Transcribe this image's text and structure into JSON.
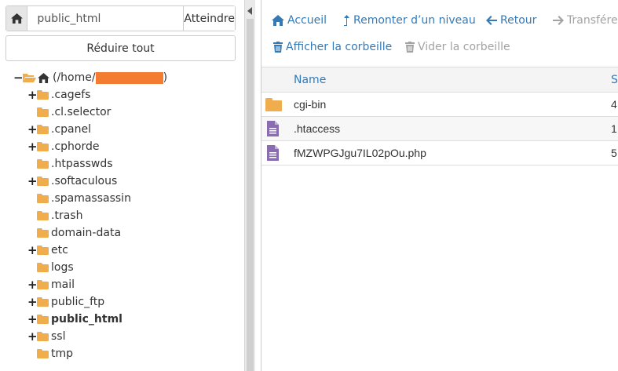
{
  "pathbar": {
    "home_icon": "home-icon",
    "path_value": "public_html",
    "go_label": "Atteindre"
  },
  "collapse_label": "Réduire tout",
  "tree": {
    "root": {
      "prefix": "(/home/",
      "suffix": ")",
      "redacted": true,
      "toggle": "−",
      "icons": [
        "folder-open-icon",
        "home-icon"
      ]
    },
    "items": [
      {
        "label": ".cagefs",
        "toggle": "+",
        "bold": false
      },
      {
        "label": ".cl.selector",
        "toggle": "",
        "bold": false
      },
      {
        "label": ".cpanel",
        "toggle": "+",
        "bold": false
      },
      {
        "label": ".cphorde",
        "toggle": "+",
        "bold": false
      },
      {
        "label": ".htpasswds",
        "toggle": "",
        "bold": false
      },
      {
        "label": ".softaculous",
        "toggle": "+",
        "bold": false
      },
      {
        "label": ".spamassassin",
        "toggle": "",
        "bold": false
      },
      {
        "label": ".trash",
        "toggle": "",
        "bold": false
      },
      {
        "label": "domain-data",
        "toggle": "",
        "bold": false
      },
      {
        "label": "etc",
        "toggle": "+",
        "bold": false
      },
      {
        "label": "logs",
        "toggle": "",
        "bold": false
      },
      {
        "label": "mail",
        "toggle": "+",
        "bold": false
      },
      {
        "label": "public_ftp",
        "toggle": "+",
        "bold": false
      },
      {
        "label": "public_html",
        "toggle": "+",
        "bold": true
      },
      {
        "label": "ssl",
        "toggle": "+",
        "bold": false
      },
      {
        "label": "tmp",
        "toggle": "",
        "bold": false
      }
    ]
  },
  "toolbar": {
    "home_label": "Accueil",
    "up_label": "Remonter d’un niveau",
    "back_label": "Retour",
    "forward_label": "Transférer",
    "trash_label": "Afficher la corbeille",
    "empty_trash_label": "Vider la corbeille"
  },
  "table": {
    "headers": {
      "name": "Name",
      "size": "S"
    },
    "rows": [
      {
        "name": "cgi-bin",
        "size": "4",
        "icon": "folder-icon"
      },
      {
        "name": ".htaccess",
        "size": "1",
        "icon": "file-text-icon"
      },
      {
        "name": "fMZWPGJgu7IL02pOu.php",
        "size": "5",
        "icon": "file-text-icon"
      }
    ]
  },
  "colors": {
    "link": "#337ab7",
    "folder": "#f0ad4e",
    "file_icon": "#8a6db1",
    "redaction": "#f47c30",
    "disabled": "#a3a3a3"
  }
}
